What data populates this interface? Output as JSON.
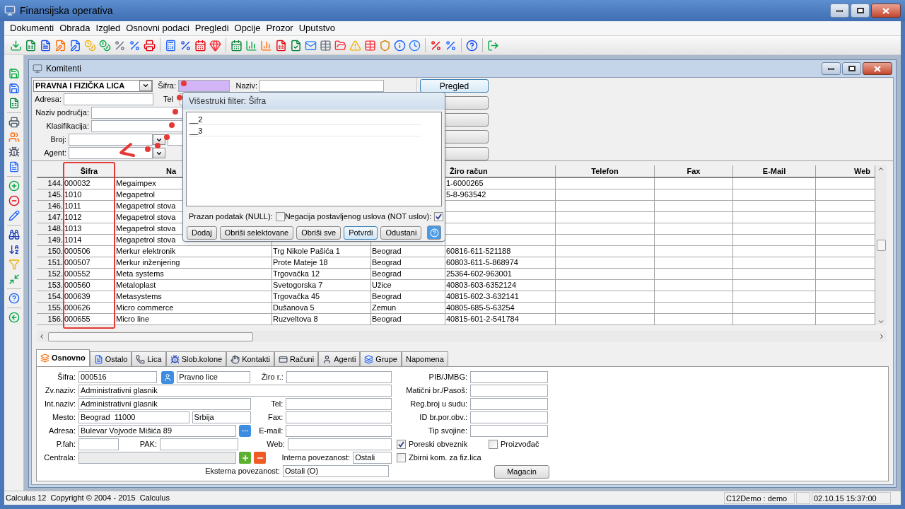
{
  "window": {
    "title": "Finansijska operativa"
  },
  "menu": [
    "Dokumenti",
    "Obrada",
    "Izgled",
    "Osnovni podaci",
    "Pregledi",
    "Opcije",
    "Prozor",
    "Uputstvo"
  ],
  "child_window": {
    "title": "Komitenti"
  },
  "filter": {
    "category": "PRAVNA I FIZIČKA LICA",
    "sifra_label": "Šifra:",
    "sifra_highlighted": true,
    "naziv_label": "Naziv:",
    "adresa_label": "Adresa:",
    "tel_label": "Tel",
    "podrucje_label": "Naziv područja:",
    "klasifikacija_label": "Klasifikacija:",
    "broj_label": "Broj:",
    "agent_label": "Agent:",
    "preview_button": "Pregled"
  },
  "popup": {
    "title": "Višestruki filter: Šifra",
    "items": [
      {
        "text": "__2"
      },
      {
        "text": "__3"
      }
    ],
    "null_label": "Prazan podatak (NULL):",
    "null_checked": false,
    "not_label": "Negacija postavljenog uslova (NOT uslov):",
    "not_checked": true,
    "buttons": [
      {
        "label": "Dodaj",
        "default": false
      },
      {
        "label": "Obriši selektovane",
        "default": false
      },
      {
        "label": "Obriši sve",
        "default": false
      },
      {
        "label": "Potvrdi",
        "default": true
      },
      {
        "label": "Odustani",
        "default": false
      }
    ]
  },
  "table": {
    "columns": [
      "Šifra",
      "Na",
      null,
      null,
      "Žiro račun",
      "Telefon",
      "Fax",
      "E-Mail",
      "Web"
    ],
    "rows": [
      {
        "number": "144.",
        "cells": [
          "000032",
          "Megaimpex",
          null,
          null,
          "1-6000265"
        ]
      },
      {
        "number": "145.",
        "cells": [
          "1010",
          "Megapetrol",
          null,
          null,
          "5-8-963542"
        ]
      },
      {
        "number": "146.",
        "cells": [
          "1011",
          "Megapetrol stova",
          null,
          null,
          null
        ]
      },
      {
        "number": "147.",
        "cells": [
          "1012",
          "Megapetrol stova",
          null,
          null,
          null
        ]
      },
      {
        "number": "148.",
        "cells": [
          "1013",
          "Megapetrol stova",
          null,
          null,
          null
        ]
      },
      {
        "number": "149.",
        "cells": [
          "1014",
          "Megapetrol stova",
          null,
          null,
          null
        ]
      },
      {
        "number": "150.",
        "cells": [
          "000506",
          "Merkur elektronik",
          "Trg Nikole Pašića 1",
          "Beograd",
          "60816-611-521188"
        ]
      },
      {
        "number": "151.",
        "cells": [
          "000507",
          "Merkur inženjering",
          "Prote Mateje 18",
          "Beograd",
          "60803-611-5-868974"
        ]
      },
      {
        "number": "152.",
        "cells": [
          "000552",
          "Meta systems",
          "Trgovačka 12",
          "Beograd",
          "25364-602-963001"
        ]
      },
      {
        "number": "153.",
        "cells": [
          "000560",
          "Metaloplast",
          "Svetogorska 7",
          "Užice",
          "40803-603-6352124"
        ]
      },
      {
        "number": "154.",
        "cells": [
          "000639",
          "Metasystems",
          "Trgovačka 45",
          "Beograd",
          "40815-602-3-632141"
        ]
      },
      {
        "number": "155.",
        "cells": [
          "000626",
          "Micro commerce",
          "Dušanova 5",
          "Zemun",
          "40805-685-5-63254"
        ]
      },
      {
        "number": "156.",
        "cells": [
          "000655",
          "Micro line",
          "Ruzveltova 8",
          "Beograd",
          "40815-601-2-541784"
        ]
      }
    ]
  },
  "tabs": [
    {
      "label": "Osnovno",
      "selected": true
    },
    {
      "label": "Ostalo",
      "selected": false
    },
    {
      "label": "Lica",
      "selected": false
    },
    {
      "label": "Slob.kolone",
      "selected": false
    },
    {
      "label": "Kontakti",
      "selected": false
    },
    {
      "label": "Računi",
      "selected": false
    },
    {
      "label": "Agenti",
      "selected": false
    },
    {
      "label": "Grupe",
      "selected": false
    },
    {
      "label": "Napomena",
      "selected": false
    }
  ],
  "form": {
    "sifra": {
      "label": "Šifra:",
      "value": "000516"
    },
    "tip": "Pravno lice",
    "zvnaziv": {
      "label": "Zv.naziv:",
      "value": "Administrativni glasnik"
    },
    "intnaziv": {
      "label": "Int.naziv:",
      "value": "Administrativni glasnik"
    },
    "mesto": {
      "label": "Mesto:",
      "value": "Beograd  11000"
    },
    "drzava": "Srbija",
    "adresa": {
      "label": "Adresa:",
      "value": "Bulevar Vojvode Mišića 89"
    },
    "pfah_label": "P.fah:",
    "pak_label": "PAK:",
    "centrala": {
      "label": "Centrala:",
      "disabled": true
    },
    "ziro_label": "Žiro r.:",
    "tel_label": "Tel:",
    "fax_label": "Fax:",
    "email_label": "E-mail:",
    "web_label": "Web:",
    "interna": {
      "label": "Interna povezanost:",
      "value": "Ostali"
    },
    "eksterna": {
      "label": "Eksterna povezanost:",
      "value": "Ostali (O)"
    },
    "right_fields": [
      {
        "label": "PIB/JMBG:"
      },
      {
        "label": "Matični br./Pasoš:"
      },
      {
        "label": "Reg.broj u sudu:"
      },
      {
        "label": "ID br.por.obv.:"
      },
      {
        "label": "Tip svojine:"
      }
    ],
    "checks": [
      {
        "label": "Poreski obveznik",
        "checked": true
      },
      {
        "label": "Proizvođač",
        "checked": false
      },
      {
        "label": "Zbirni kom. za fiz.lica",
        "checked": false
      }
    ],
    "magacin_button": "Magacin"
  },
  "status_bar": {
    "left": "Calculus 12  Copyright © 2004 - 2015  Calculus",
    "user": "C12Demo : demo",
    "time": "02.10.15 15:37:00"
  }
}
